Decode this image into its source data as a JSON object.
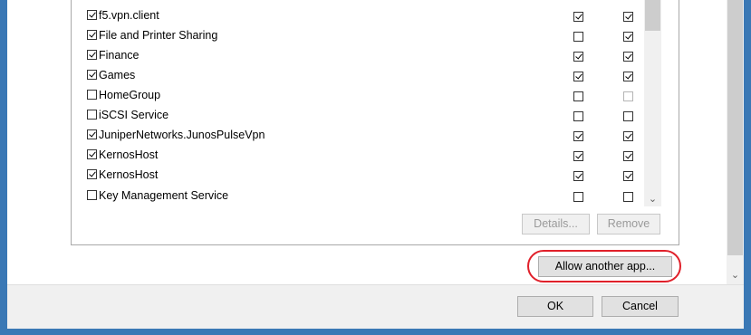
{
  "apps": [
    {
      "name": "f5.vpn.client",
      "enabled": true,
      "private": true,
      "public": true
    },
    {
      "name": "File and Printer Sharing",
      "enabled": true,
      "private": false,
      "public": true
    },
    {
      "name": "Finance",
      "enabled": true,
      "private": true,
      "public": true
    },
    {
      "name": "Games",
      "enabled": true,
      "private": true,
      "public": true
    },
    {
      "name": "HomeGroup",
      "enabled": false,
      "private": false,
      "public": false,
      "public_disabled": true
    },
    {
      "name": "iSCSI Service",
      "enabled": false,
      "private": false,
      "public": false
    },
    {
      "name": "JuniperNetworks.JunosPulseVpn",
      "enabled": true,
      "private": true,
      "public": true
    },
    {
      "name": "KernosHost",
      "enabled": true,
      "private": true,
      "public": true
    },
    {
      "name": "KernosHost",
      "enabled": true,
      "private": true,
      "public": true
    },
    {
      "name": "Key Management Service",
      "enabled": false,
      "private": false,
      "public": false
    }
  ],
  "buttons": {
    "details": "Details...",
    "remove": "Remove",
    "allow_another": "Allow another app...",
    "ok": "OK",
    "cancel": "Cancel"
  },
  "icons": {
    "scroll_down": "chevron-down-icon"
  }
}
